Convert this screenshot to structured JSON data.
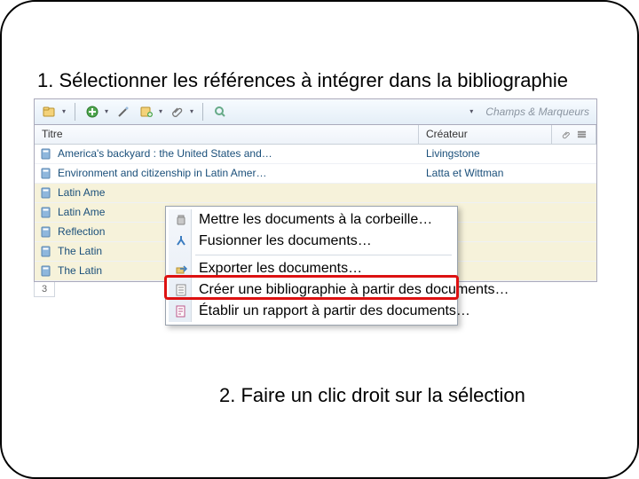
{
  "step1": "1. Sélectionner les références à intégrer dans la bibliographie",
  "step2": "2. Faire un clic droit sur la sélection",
  "toolbar_placeholder": "Champs & Marqueurs",
  "columns": {
    "title": "Titre",
    "creator": "Créateur"
  },
  "rows": [
    {
      "title": "America's backyard : the United States and…",
      "creator": "Livingstone",
      "sel": false
    },
    {
      "title": "Environment and citizenship in Latin Amer…",
      "creator": "Latta et Wittman",
      "sel": false
    },
    {
      "title": "Latin Ame",
      "creator": "",
      "sel": true
    },
    {
      "title": "Latin Ame",
      "creator": "",
      "sel": true
    },
    {
      "title": "Reflection",
      "creator": "",
      "sel": true
    },
    {
      "title": "The Latin",
      "creator": "",
      "sel": true
    },
    {
      "title": "The Latin",
      "creator": "",
      "sel": true
    }
  ],
  "pager": "3",
  "menu": {
    "trash": "Mettre les documents à la corbeille…",
    "merge": "Fusionner les documents…",
    "export": "Exporter les documents…",
    "biblio": "Créer une bibliographie à partir des documents…",
    "report": "Établir un rapport à partir des documents…"
  }
}
